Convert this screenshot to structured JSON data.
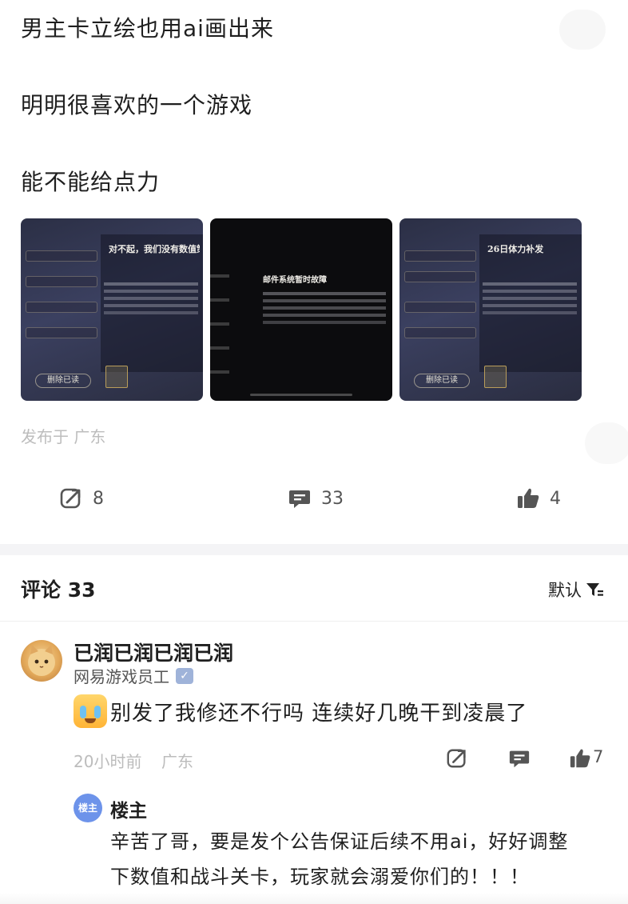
{
  "post": {
    "lines": [
      "男主卡立绘也用ai画出来",
      "明明很喜欢的一个游戏",
      "能不能给点力"
    ],
    "images": [
      {
        "title": "对不起，我们没有数值策",
        "button": "删除已读"
      },
      {
        "title": "邮件系统暂时故障"
      },
      {
        "title": "26日体力补发",
        "button": "删除已读"
      }
    ],
    "location": "发布于 广东",
    "actions": {
      "share_count": "8",
      "comment_count": "33",
      "like_count": "4"
    }
  },
  "comments": {
    "title": "评论 33",
    "sort_label": "默认",
    "items": [
      {
        "user": "已润已润已润已润",
        "tag": "网易游戏员工",
        "text": "别发了我修还不行吗 连续好几晚干到凌晨了",
        "time": "20小时前",
        "location": "广东",
        "like_count": "7",
        "reply": {
          "badge": "楼主",
          "name": "楼主",
          "line1": "辛苦了哥，要是发个公告保证后续不用ai，好好调整",
          "line2": "下数值和战斗关卡，玩家就会溺爱你们的！！！"
        }
      }
    ]
  },
  "colors": {
    "accent": "#6d93ea",
    "muted": "#bcbcbc",
    "icon": "#555555"
  }
}
